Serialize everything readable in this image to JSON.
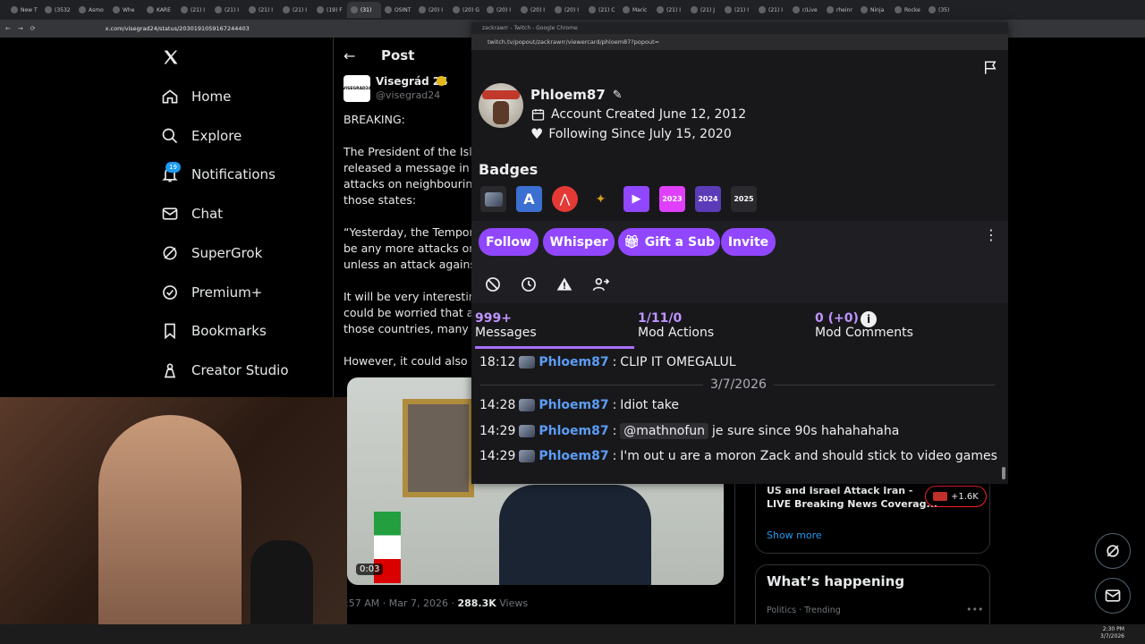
{
  "browser": {
    "tabs": [
      "New T",
      "(3532",
      "Asmo",
      "Whe",
      "KARE",
      "(21) I",
      "(21) I",
      "(21) I",
      "(21) I",
      "(19) F",
      "(31)",
      "OSINT",
      "(20) I",
      "(20) G",
      "(20) I",
      "(20) I",
      "(20) I",
      "(21) C",
      "Maric",
      "(21) I",
      "(21) J",
      "(21) I",
      "(21) I",
      "r/Live",
      "rheinr",
      "Ninja",
      "Rocke",
      "(35)"
    ],
    "url": "x.com/visegrad24/status/2030191059167244403"
  },
  "x_nav": {
    "items": [
      "Home",
      "Explore",
      "Notifications",
      "Chat",
      "SuperGrok",
      "Premium+",
      "Bookmarks",
      "Creator Studio"
    ],
    "notif_count": "19"
  },
  "post": {
    "header": "Post",
    "author_name": "Visegrád 24",
    "author_handle": "@visegrad24",
    "avatar_text": "VISEGRAD24",
    "lines": [
      "BREAKING:",
      "",
      "The President of the Islar",
      "released a message in w",
      "attacks on neighbouring",
      "those states:",
      "",
      "“Yesterday, the Tempora",
      "be any more attacks on r",
      "unless an attack against",
      "",
      "It will be very interesting",
      "could be worried that ad",
      "those countries, many of",
      "",
      "However, it could also be"
    ],
    "video_time": "0:03",
    "meta_time": ":57 AM · Mar 7, 2026 · ",
    "views_count": "288.3K",
    "views_label": " Views"
  },
  "sidebar_right": {
    "trend_title": "US and Israel Attack Iran -",
    "trend_subtitle": "LIVE Breaking News Coverag...",
    "trend_count": "+1.6K",
    "show_more": "Show more",
    "whats_happening": "What’s happening",
    "trending_meta": "Politics · Trending"
  },
  "popup": {
    "title": "zackrawrr - Twitch - Google Chrome",
    "url": "twitch.tv/popout/zackrawrr/viewercard/phloem87?popout=",
    "username": "Phloem87",
    "account_created": "Account Created June 12, 2012",
    "following_since": "Following Since July 15, 2020",
    "badges_heading": "Badges",
    "buttons": {
      "follow": "Follow",
      "whisper": "Whisper",
      "gift": "Gift a Sub",
      "invite": "Invite"
    },
    "stats": [
      {
        "num": "999+",
        "label": "Messages"
      },
      {
        "num": "1/11/0",
        "label": "Mod Actions"
      },
      {
        "num": "0 (+0)",
        "label": "Mod Comments"
      }
    ],
    "badges": [
      "bow-badge",
      "a-badge",
      "red-a-badge",
      "bird-badge",
      "prime-badge",
      "2023-badge",
      "2024-badge",
      "2025-badge"
    ],
    "badge_texts": [
      "2023",
      "2024",
      "2025"
    ],
    "date_divider": "3/7/2026",
    "messages": [
      {
        "time": "18:12",
        "user": "Phloem87",
        "text": "CLIP IT OMEGALUL"
      },
      {
        "time": "14:28",
        "user": "Phloem87",
        "text": "Idiot take"
      },
      {
        "time": "14:29",
        "user": "Phloem87",
        "mention": "@mathnofun",
        "text": "je sure since 90s hahahahaha"
      },
      {
        "time": "14:29",
        "user": "Phloem87",
        "text": "I'm out u are a moron Zack and should stick to video games"
      }
    ]
  },
  "taskbar": {
    "time": "2:30 PM",
    "date": "3/7/2026"
  },
  "colors": {
    "twitch_purple": "#9147ff",
    "twitch_accent": "#bf94ff",
    "x_blue": "#1d9bf0"
  }
}
